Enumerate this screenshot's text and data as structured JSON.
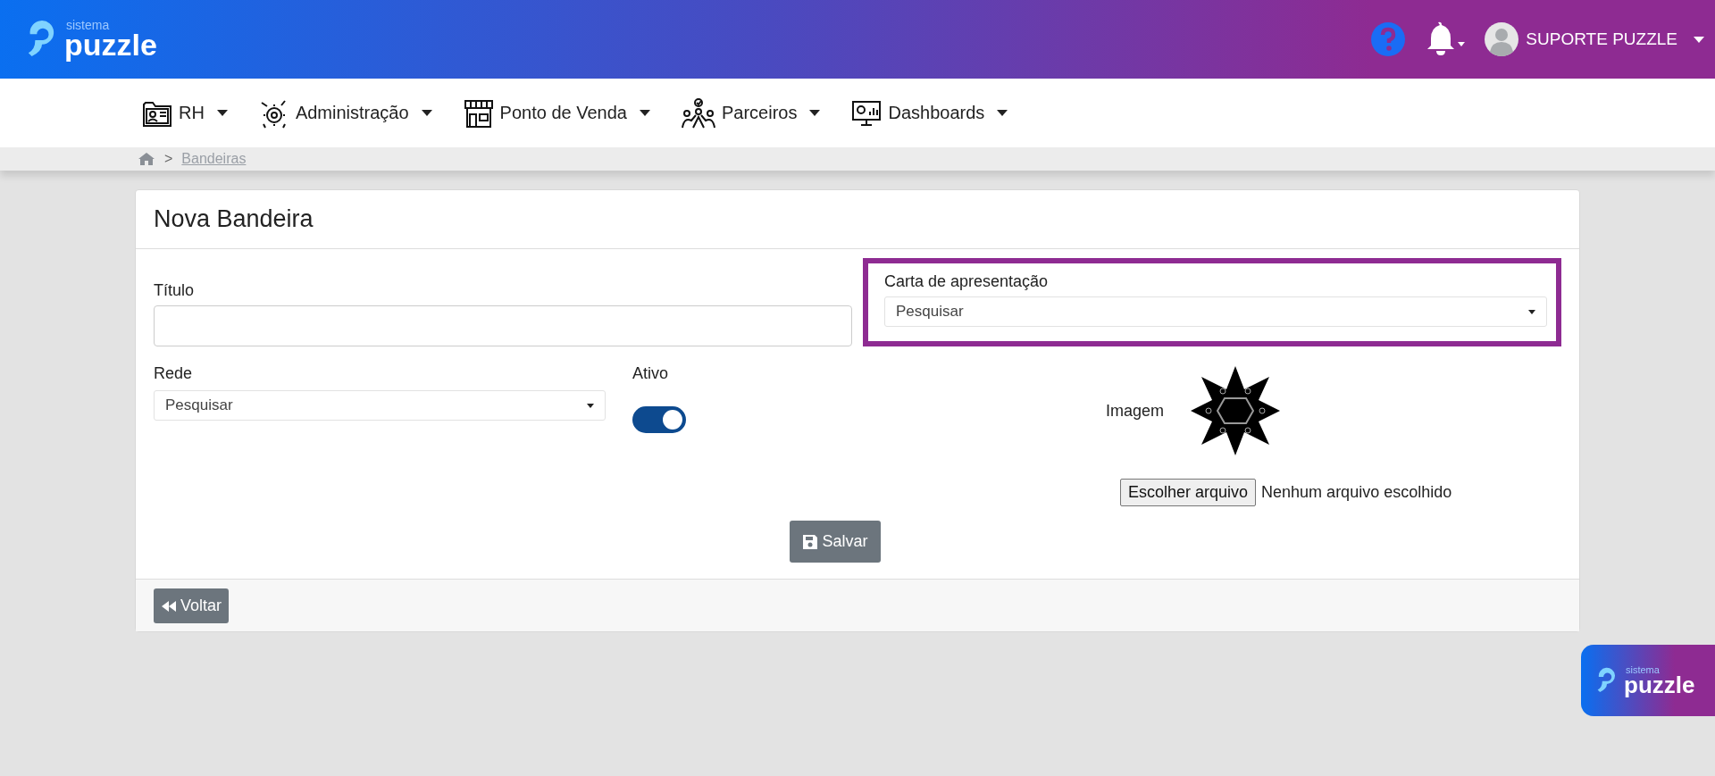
{
  "header": {
    "logo_small": "sistema",
    "logo_big": "puzzle",
    "user": "SUPORTE PUZZLE"
  },
  "nav": [
    {
      "label": "RH",
      "kind": "folder"
    },
    {
      "label": "Administração",
      "kind": "gears"
    },
    {
      "label": "Ponto de Venda",
      "kind": "store"
    },
    {
      "label": "Parceiros",
      "kind": "people"
    },
    {
      "label": "Dashboards",
      "kind": "monitor"
    }
  ],
  "breadcrumb": {
    "link": "Bandeiras",
    "separator": ">"
  },
  "form": {
    "title": "Nova Bandeira",
    "titulo": {
      "label": "Título"
    },
    "carta": {
      "label": "Carta de apresentação",
      "placeholder": "Pesquisar",
      "highlighted": true
    },
    "rede": {
      "label": "Rede",
      "placeholder": "Pesquisar"
    },
    "ativo": {
      "label": "Ativo",
      "on": true
    },
    "imagem": {
      "label": "Imagem",
      "file_button": "Escolher arquivo",
      "file_status": "Nenhum arquivo escolhido"
    },
    "save": "Salvar",
    "back": "Voltar"
  },
  "badge": {
    "logo_small": "sistema",
    "logo_big": "puzzle"
  }
}
